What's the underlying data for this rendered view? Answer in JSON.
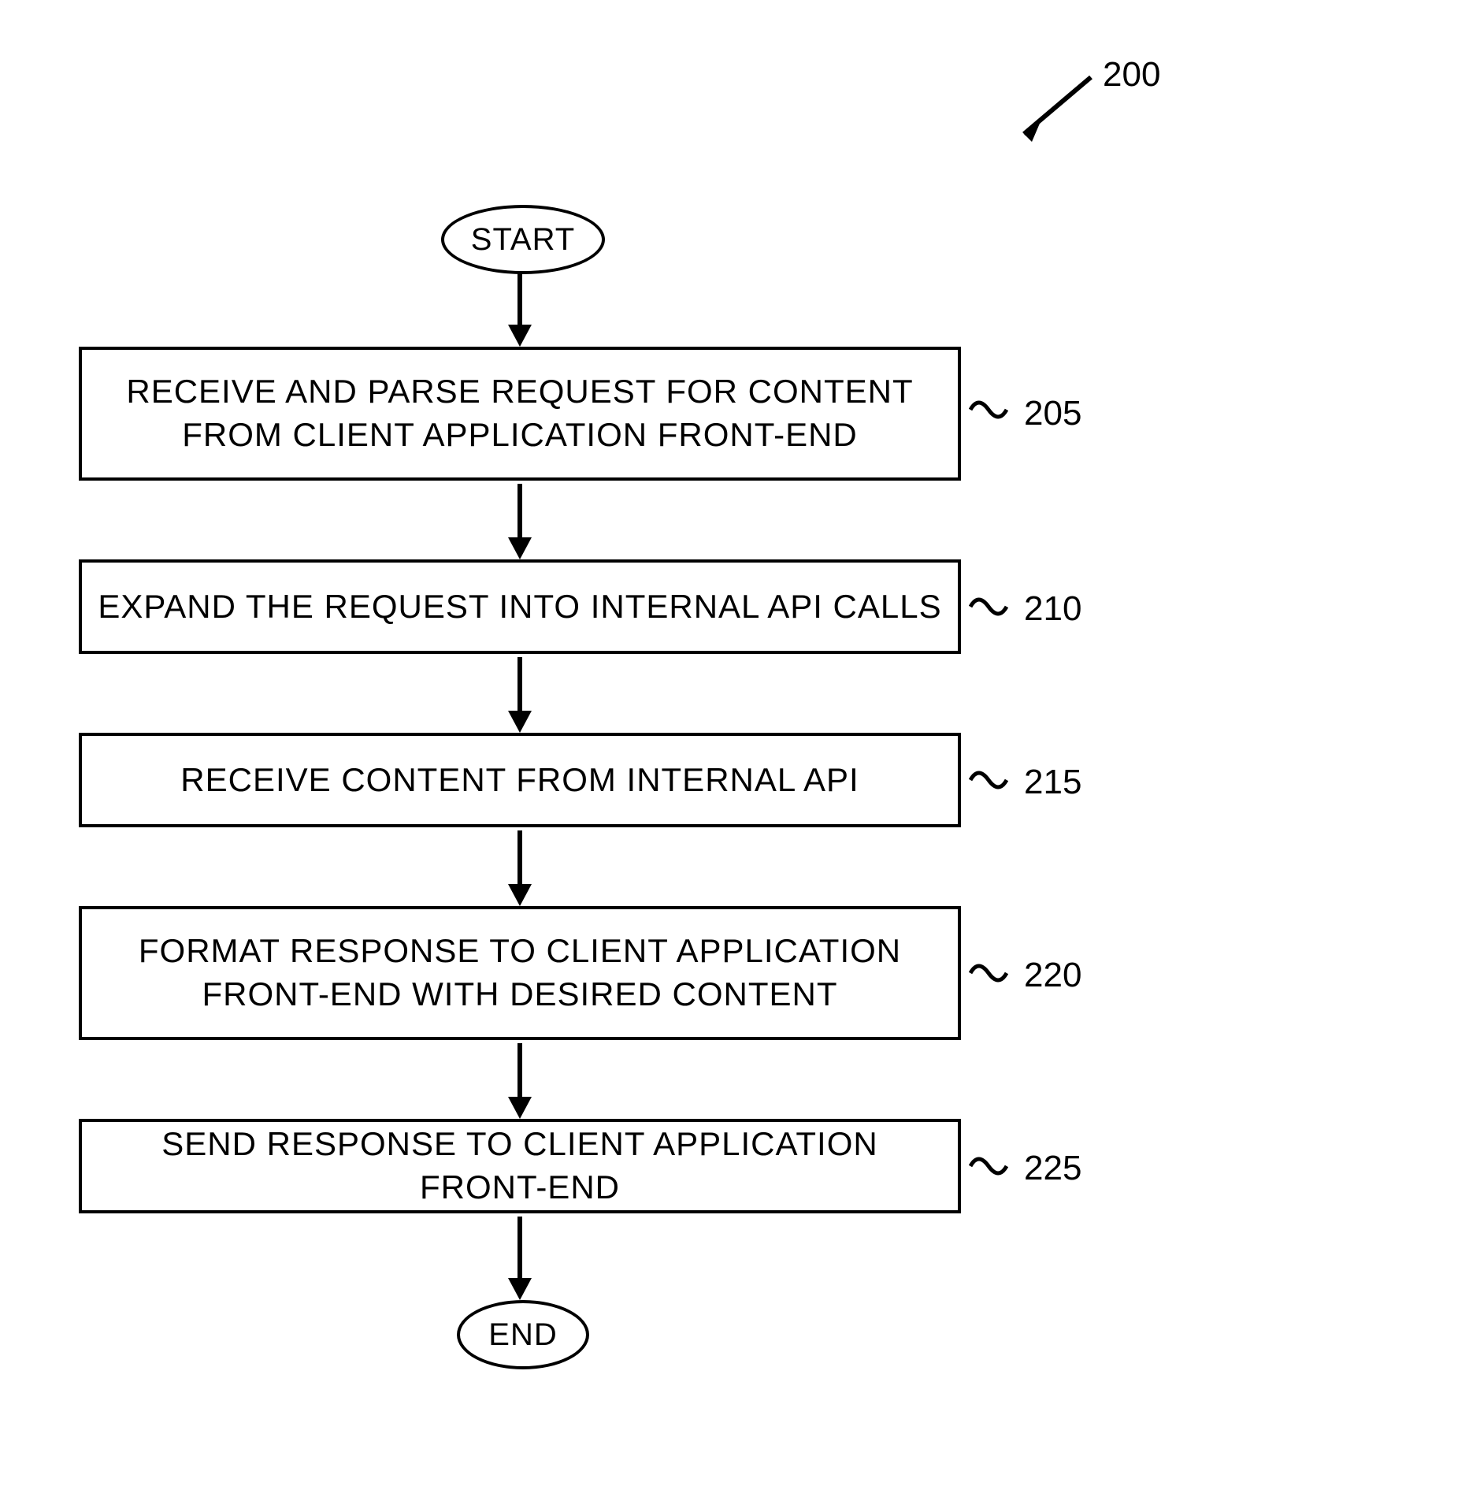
{
  "figure_ref": "200",
  "start_label": "START",
  "end_label": "END",
  "steps": [
    {
      "ref": "205",
      "text": "RECEIVE AND PARSE REQUEST FOR  CONTENT FROM CLIENT APPLICATION FRONT-END"
    },
    {
      "ref": "210",
      "text": "EXPAND THE REQUEST INTO INTERNAL API CALLS"
    },
    {
      "ref": "215",
      "text": "RECEIVE  CONTENT FROM INTERNAL  API"
    },
    {
      "ref": "220",
      "text": "FORMAT RESPONSE TO CLIENT APPLICATION FRONT-END WITH DESIRED CONTENT"
    },
    {
      "ref": "225",
      "text": "SEND RESPONSE TO CLIENT APPLICATION FRONT-END"
    }
  ],
  "chart_data": {
    "type": "flowchart",
    "title": "",
    "nodes": [
      {
        "id": "start",
        "kind": "terminal",
        "label": "START"
      },
      {
        "id": "205",
        "kind": "process",
        "label": "RECEIVE AND PARSE REQUEST FOR CONTENT FROM CLIENT APPLICATION FRONT-END"
      },
      {
        "id": "210",
        "kind": "process",
        "label": "EXPAND THE REQUEST INTO INTERNAL API CALLS"
      },
      {
        "id": "215",
        "kind": "process",
        "label": "RECEIVE CONTENT FROM INTERNAL API"
      },
      {
        "id": "220",
        "kind": "process",
        "label": "FORMAT RESPONSE TO CLIENT APPLICATION FRONT-END WITH DESIRED CONTENT"
      },
      {
        "id": "225",
        "kind": "process",
        "label": "SEND RESPONSE TO CLIENT APPLICATION FRONT-END"
      },
      {
        "id": "end",
        "kind": "terminal",
        "label": "END"
      }
    ],
    "edges": [
      {
        "from": "start",
        "to": "205"
      },
      {
        "from": "205",
        "to": "210"
      },
      {
        "from": "210",
        "to": "215"
      },
      {
        "from": "215",
        "to": "220"
      },
      {
        "from": "220",
        "to": "225"
      },
      {
        "from": "225",
        "to": "end"
      }
    ],
    "figure_number": "200"
  }
}
